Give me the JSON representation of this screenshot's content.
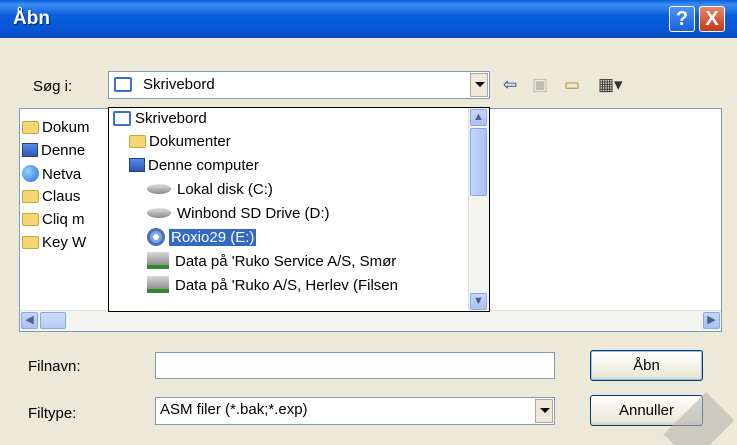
{
  "window": {
    "title": "Åbn"
  },
  "titlebar_buttons": {
    "help": "?",
    "close": "X"
  },
  "lookin": {
    "label": "Søg i:",
    "value": "Skrivebord"
  },
  "toolbar": {
    "back_icon": "back-arrow-icon",
    "up_icon": "up-folder-icon",
    "newfolder_icon": "new-folder-icon",
    "views_icon": "views-menu-icon"
  },
  "list": {
    "items": [
      {
        "label": "Dokum",
        "icon": "folder-icon"
      },
      {
        "label": "Denne",
        "icon": "computer-icon"
      },
      {
        "label": "Netva",
        "icon": "network-icon"
      },
      {
        "label": "Claus",
        "icon": "folder-icon"
      },
      {
        "label": "Cliq m",
        "icon": "folder-icon"
      },
      {
        "label": "Key W",
        "icon": "folder-icon"
      }
    ]
  },
  "dropdown": {
    "items": [
      {
        "label": "Skrivebord",
        "icon": "desktop-icon",
        "indent": 0
      },
      {
        "label": "Dokumenter",
        "icon": "folder-icon",
        "indent": 1
      },
      {
        "label": "Denne computer",
        "icon": "computer-icon",
        "indent": 1
      },
      {
        "label": "Lokal disk (C:)",
        "icon": "hard-disk-icon",
        "indent": 2
      },
      {
        "label": "Winbond SD Drive (D:)",
        "icon": "hard-disk-icon",
        "indent": 2
      },
      {
        "label": "Roxio29 (E:)",
        "icon": "cd-drive-icon",
        "indent": 2,
        "selected": true
      },
      {
        "label": "Data på 'Ruko Service A/S, Smør",
        "icon": "network-drive-icon",
        "indent": 2
      },
      {
        "label": "Data på 'Ruko A/S, Herlev (Filsen",
        "icon": "network-drive-icon",
        "indent": 2
      }
    ]
  },
  "filename": {
    "label": "Filnavn:",
    "value": ""
  },
  "filetype": {
    "label": "Filtype:",
    "value": "ASM filer (*.bak;*.exp)"
  },
  "buttons": {
    "open": "Åbn",
    "cancel": "Annuller"
  }
}
